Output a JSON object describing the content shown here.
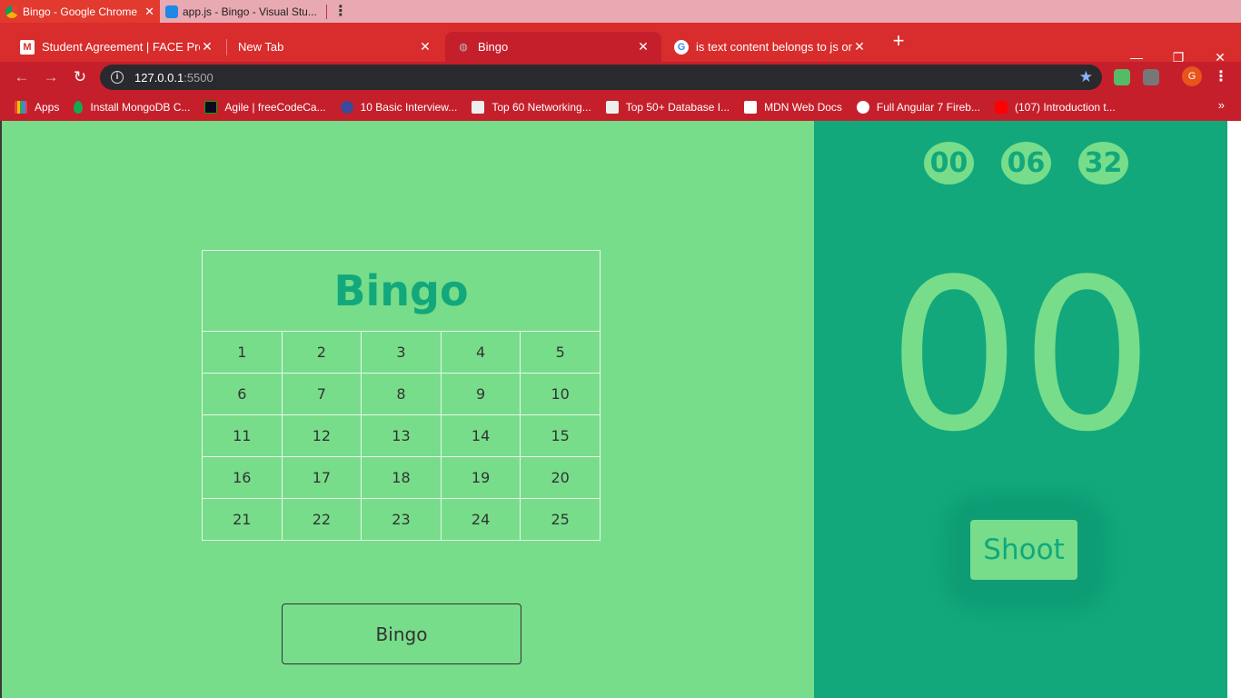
{
  "os": {
    "items": [
      {
        "label": "Bingo - Google Chrome",
        "active": true
      },
      {
        "label": "app.js - Bingo - Visual Stu...",
        "active": false
      }
    ]
  },
  "browser": {
    "tabs": [
      {
        "label": "Student Agreement | FACE ProGr"
      },
      {
        "label": "New Tab"
      },
      {
        "label": "Bingo"
      },
      {
        "label": "is text content belongs to js or jq"
      }
    ],
    "url_host": "127.0.0.1",
    "url_port": ":5500",
    "profile_initial": "G",
    "bookmarks": [
      "Apps",
      "Install MongoDB C...",
      "Agile | freeCodeCa...",
      "10 Basic Interview...",
      "Top 60 Networking...",
      "Top 50+ Database I...",
      "MDN Web Docs",
      "Full Angular 7 Fireb...",
      "(107) Introduction t..."
    ]
  },
  "game": {
    "title": "Bingo",
    "rows": [
      [
        "1",
        "2",
        "3",
        "4",
        "5"
      ],
      [
        "6",
        "7",
        "8",
        "9",
        "10"
      ],
      [
        "11",
        "12",
        "13",
        "14",
        "15"
      ],
      [
        "16",
        "17",
        "18",
        "19",
        "20"
      ],
      [
        "21",
        "22",
        "23",
        "24",
        "25"
      ]
    ],
    "bingo_button": "Bingo",
    "timer": {
      "hours": "00",
      "minutes": "06",
      "seconds": "32"
    },
    "current_number": "00",
    "shoot_button": "Shoot"
  }
}
